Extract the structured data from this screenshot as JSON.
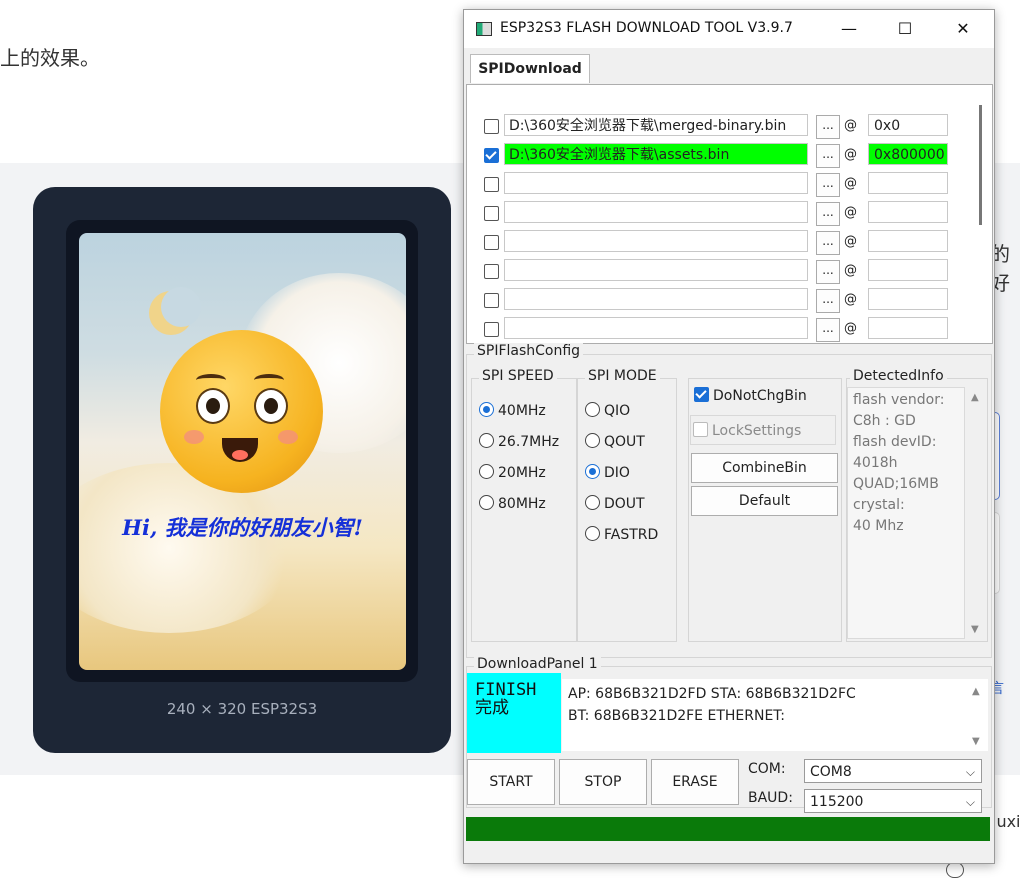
{
  "background_page": {
    "text_top": "上的效果。",
    "text_right": "的好",
    "text_cut": "luxia",
    "device_caption": "240 × 320 ESP32S3",
    "device_screen_text": "Hi, 我是你的好朋友小智!"
  },
  "window": {
    "title": "ESP32S3 FLASH DOWNLOAD TOOL V3.9.7",
    "min": "—",
    "max": "☐",
    "close": "✕"
  },
  "tabs": [
    {
      "label": "SPIDownload"
    }
  ],
  "files": [
    {
      "checked": true,
      "path": "D:\\360安全浏览器下载\\merged-binary.bin",
      "addr": "0x0",
      "highlight": false
    },
    {
      "checked": true,
      "path": "D:\\360安全浏览器下载\\assets.bin",
      "addr": "0x800000",
      "highlight": true
    },
    {
      "checked": false,
      "path": "",
      "addr": ""
    },
    {
      "checked": false,
      "path": "",
      "addr": ""
    },
    {
      "checked": false,
      "path": "",
      "addr": ""
    },
    {
      "checked": false,
      "path": "",
      "addr": ""
    },
    {
      "checked": false,
      "path": "",
      "addr": ""
    },
    {
      "checked": false,
      "path": "",
      "addr": ""
    }
  ],
  "file_button_label": "...",
  "at_symbol": "@",
  "spiflashconfig": {
    "title": "SPIFlashConfig",
    "speed_title": "SPI SPEED",
    "speeds": [
      "40MHz",
      "26.7MHz",
      "20MHz",
      "80MHz"
    ],
    "speed_selected": "40MHz",
    "mode_title": "SPI MODE",
    "modes": [
      "QIO",
      "QOUT",
      "DIO",
      "DOUT",
      "FASTRD"
    ],
    "mode_selected": "DIO",
    "donotchgbin": "DoNotChgBin",
    "locksettings": "LockSettings",
    "combinebin": "CombineBin",
    "default": "Default"
  },
  "detected": {
    "title": "DetectedInfo",
    "lines": [
      "flash vendor:",
      "C8h : GD",
      "flash devID:",
      "4018h",
      "QUAD;16MB",
      "crystal:",
      "40 Mhz"
    ]
  },
  "download_panel": {
    "title": "DownloadPanel 1",
    "finish_en": "FINISH",
    "finish_cn": "完成",
    "mac_line1": "AP:  68B6B321D2FD  STA:  68B6B321D2FC",
    "mac_line2": "BT:  68B6B321D2FE  ETHERNET:"
  },
  "controls": {
    "start": "START",
    "stop": "STOP",
    "erase": "ERASE",
    "com_label": "COM:",
    "com_value": "COM8",
    "baud_label": "BAUD:",
    "baud_value": "115200"
  },
  "progress": 1.0,
  "colors": {
    "highlight_green": "#00ff00",
    "finish_cyan": "#00ffff",
    "progress_green": "#0a7a0a"
  }
}
